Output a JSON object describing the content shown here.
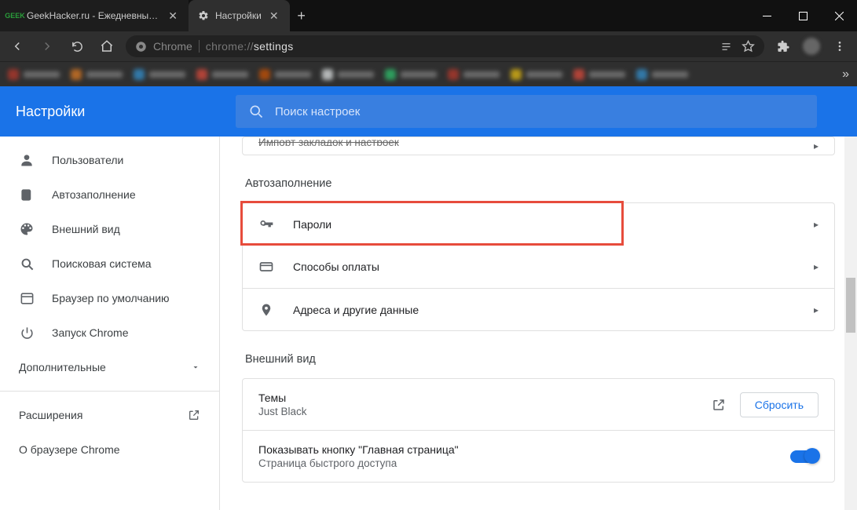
{
  "window": {
    "tabs": [
      {
        "title": "GeekHacker.ru - Ежедневный ж…",
        "favicon": "geek",
        "active": false
      },
      {
        "title": "Настройки",
        "favicon": "gear",
        "active": true
      }
    ]
  },
  "toolbar": {
    "chrome_label": "Chrome",
    "url_prefix": "chrome://",
    "url_path": "settings"
  },
  "settings": {
    "title": "Настройки",
    "search_placeholder": "Поиск настроек",
    "nav": [
      {
        "label": "Пользователи",
        "icon": "person"
      },
      {
        "label": "Автозаполнение",
        "icon": "assignment"
      },
      {
        "label": "Внешний вид",
        "icon": "palette"
      },
      {
        "label": "Поисковая система",
        "icon": "search"
      },
      {
        "label": "Браузер по умолчанию",
        "icon": "browser"
      },
      {
        "label": "Запуск Chrome",
        "icon": "power"
      }
    ],
    "advanced_label": "Дополнительные",
    "extensions_label": "Расширения",
    "about_label": "О браузере Chrome"
  },
  "content": {
    "truncated_row": "Импорт закладок и настроек",
    "autofill": {
      "title": "Автозаполнение",
      "rows": [
        {
          "label": "Пароли",
          "icon": "key",
          "highlighted": true
        },
        {
          "label": "Способы оплаты",
          "icon": "card"
        },
        {
          "label": "Адреса и другие данные",
          "icon": "place"
        }
      ]
    },
    "appearance": {
      "title": "Внешний вид",
      "theme": {
        "label": "Темы",
        "value": "Just Black",
        "reset_label": "Сбросить"
      },
      "home_button": {
        "label": "Показывать кнопку \"Главная страница\"",
        "sub": "Страница быстрого доступа",
        "enabled": true
      }
    }
  }
}
